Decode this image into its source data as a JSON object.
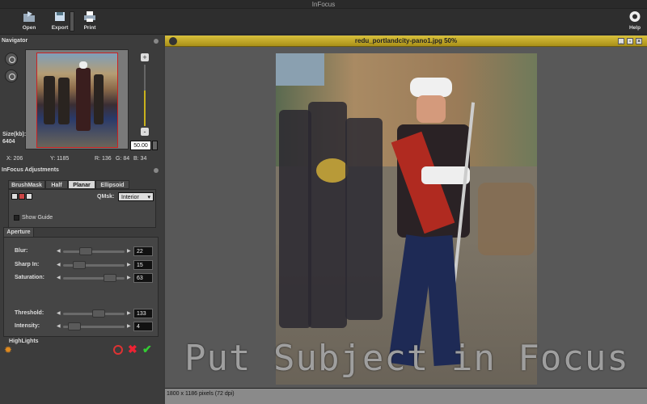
{
  "window": {
    "title": "InFocus"
  },
  "toolbar": {
    "open_label": "Open",
    "export_label": "Export",
    "print_label": "Print",
    "help_label": "Help"
  },
  "navigator": {
    "title": "Navigator",
    "zoom_value": "50.00",
    "size_label": "Size(kb):",
    "size_value": "6404",
    "x_label": "X: 206",
    "y_label": "Y: 1185",
    "r_label": "R: 136",
    "g_label": "G: 84",
    "b_label": "B: 34"
  },
  "adjustments": {
    "title": "InFocus Adjustments",
    "tabs": [
      "BrushMask",
      "Half",
      "Planar",
      "Ellipsoid"
    ],
    "active_tab": "Planar",
    "qmsk_label": "QMsk:",
    "qmsk_value": "Interior",
    "show_guide_label": "Show Guide",
    "aperture_tab": "Aperture",
    "blur_label": "Blur:",
    "blur_value": "22",
    "sharp_label": "Sharp In:",
    "sharp_value": "15",
    "saturation_label": "Saturation:",
    "saturation_value": "63",
    "highlights_label": "HighLights",
    "threshold_label": "Threshold:",
    "threshold_value": "133",
    "intensity_label": "Intensity:",
    "intensity_value": "4"
  },
  "viewer": {
    "title": "redu_portlandcity-pano1.jpg 50%",
    "status": "1800 x 1186 pixels (72 dpi)"
  },
  "overlay": {
    "caption": "Put Subject in Focus"
  },
  "colors": {
    "accent": "#c9b21c",
    "title_gold": "#d9c23c",
    "panel": "#3c3c3c"
  }
}
